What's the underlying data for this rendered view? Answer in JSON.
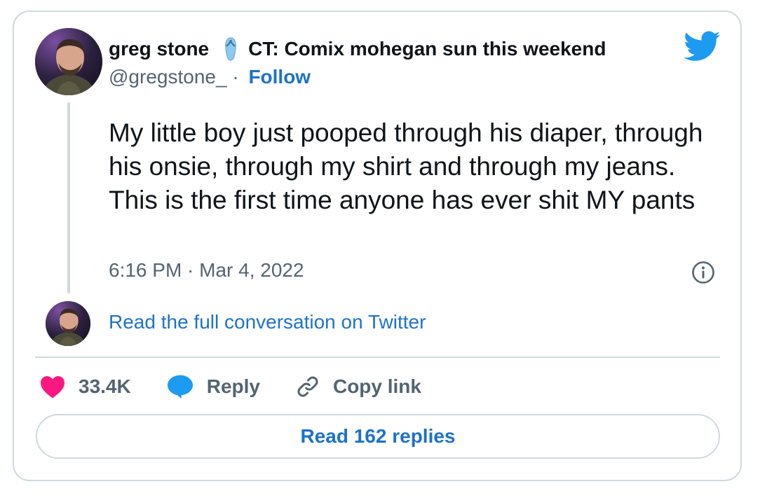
{
  "tweet": {
    "author_name": "greg stone",
    "author_status": "CT: Comix mohegan sun this weekend",
    "handle": "@gregstone_",
    "separator": " · ",
    "follow_label": "Follow",
    "text": "My little boy just pooped through his diaper, through his onsie, through my shirt and through my jeans. This is the first time anyone has ever shit MY pants",
    "timestamp": "6:16 PM · Mar 4, 2022"
  },
  "conversation": {
    "link_label": "Read the full conversation on Twitter"
  },
  "actions": {
    "likes_count": "33.4K",
    "reply_label": "Reply",
    "copy_link_label": "Copy link"
  },
  "footer": {
    "read_replies_label": "Read 162 replies"
  },
  "icons": {
    "brand": "twitter-bird-icon",
    "like": "heart-icon",
    "reply": "reply-bubble-icon",
    "copy": "link-icon",
    "info": "info-icon",
    "status_emoji": "flip-flop-icon"
  },
  "colors": {
    "link": "#1d72c8",
    "twitter_blue": "#1d9bf0",
    "heart": "#f91880",
    "muted_text": "#536471",
    "border": "#cfd9de"
  }
}
